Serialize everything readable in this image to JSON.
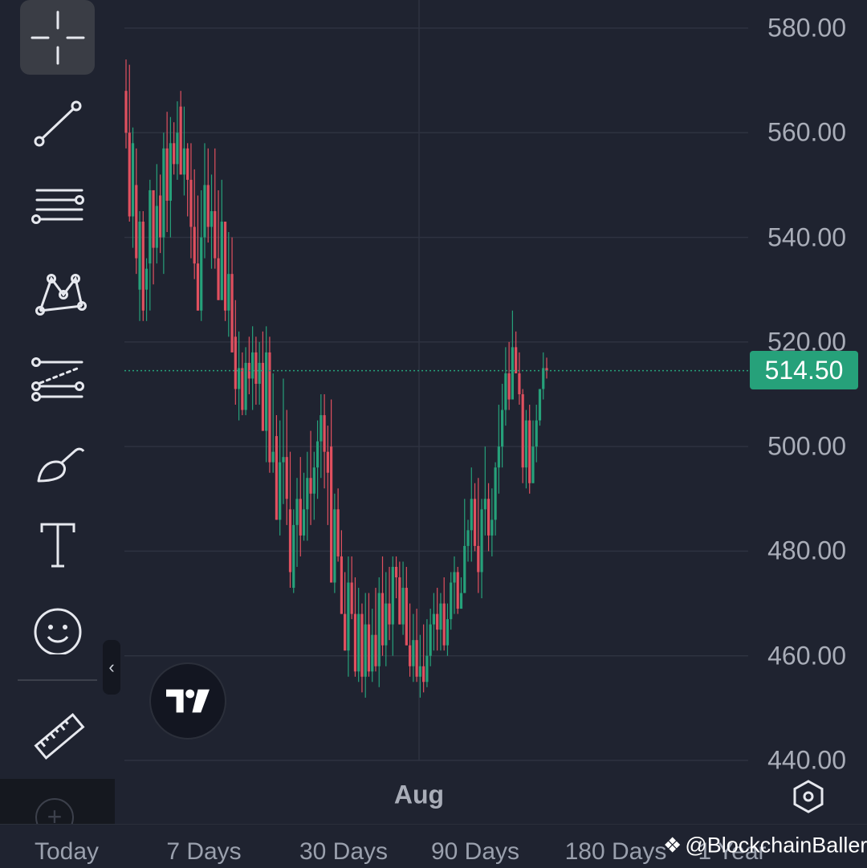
{
  "toolbar": {
    "tools": [
      {
        "name": "crosshair-tool",
        "active": true
      },
      {
        "name": "trend-line-tool"
      },
      {
        "name": "horizontal-lines-tool"
      },
      {
        "name": "pattern-tool"
      },
      {
        "name": "prediction-tool"
      },
      {
        "name": "brush-tool"
      },
      {
        "name": "text-tool"
      },
      {
        "name": "emoji-tool"
      },
      {
        "name": "ruler-tool"
      }
    ],
    "collapse_glyph": "‹",
    "add_glyph": "+"
  },
  "price_axis": {
    "labels": [
      "580.00",
      "560.00",
      "540.00",
      "520.00",
      "500.00",
      "480.00",
      "460.00",
      "440.00"
    ],
    "current_price": "514.50"
  },
  "time_axis": {
    "label": "Aug"
  },
  "ranges": [
    "Today",
    "7 Days",
    "30 Days",
    "90 Days",
    "180 Days",
    "1 Year"
  ],
  "watermark": "@BlockchainBaller",
  "colors": {
    "up": "#26a17a",
    "down": "#e0505f",
    "background": "#1f2330",
    "grid": "#2e3340"
  },
  "chart_data": {
    "type": "candlestick",
    "xlabel": "",
    "ylabel": "",
    "x_tick_labels": [
      "Aug"
    ],
    "ylim": [
      440,
      580
    ],
    "grid": true,
    "current_price": 514.5,
    "candles": [
      {
        "o": 568,
        "h": 574,
        "l": 557,
        "c": 560
      },
      {
        "o": 560,
        "h": 573,
        "l": 543,
        "c": 544
      },
      {
        "o": 544,
        "h": 561,
        "l": 538,
        "c": 558
      },
      {
        "o": 550,
        "h": 557,
        "l": 533,
        "c": 536
      },
      {
        "o": 530,
        "h": 545,
        "l": 524,
        "c": 543
      },
      {
        "o": 543,
        "h": 545,
        "l": 524,
        "c": 526
      },
      {
        "o": 530,
        "h": 536,
        "l": 524,
        "c": 534
      },
      {
        "o": 535,
        "h": 551,
        "l": 526,
        "c": 549
      },
      {
        "o": 549,
        "h": 549,
        "l": 531,
        "c": 538
      },
      {
        "o": 538,
        "h": 554,
        "l": 535,
        "c": 546
      },
      {
        "o": 548,
        "h": 552,
        "l": 537,
        "c": 540
      },
      {
        "o": 540,
        "h": 560,
        "l": 533,
        "c": 557
      },
      {
        "o": 557,
        "h": 564,
        "l": 541,
        "c": 547
      },
      {
        "o": 547,
        "h": 563,
        "l": 540,
        "c": 558
      },
      {
        "o": 558,
        "h": 562,
        "l": 552,
        "c": 554
      },
      {
        "o": 554,
        "h": 566,
        "l": 551,
        "c": 560
      },
      {
        "o": 565,
        "h": 568,
        "l": 552,
        "c": 552
      },
      {
        "o": 552,
        "h": 565,
        "l": 548,
        "c": 557
      },
      {
        "o": 557,
        "h": 558,
        "l": 544,
        "c": 551
      },
      {
        "o": 551,
        "h": 558,
        "l": 536,
        "c": 542
      },
      {
        "o": 542,
        "h": 553,
        "l": 532,
        "c": 535
      },
      {
        "o": 535,
        "h": 548,
        "l": 526,
        "c": 526
      },
      {
        "o": 526,
        "h": 549,
        "l": 524,
        "c": 540
      },
      {
        "o": 540,
        "h": 558,
        "l": 536,
        "c": 550
      },
      {
        "o": 550,
        "h": 557,
        "l": 539,
        "c": 542
      },
      {
        "o": 542,
        "h": 552,
        "l": 534,
        "c": 545
      },
      {
        "o": 545,
        "h": 557,
        "l": 534,
        "c": 536
      },
      {
        "o": 536,
        "h": 549,
        "l": 528,
        "c": 528
      },
      {
        "o": 528,
        "h": 551,
        "l": 528,
        "c": 543
      },
      {
        "o": 543,
        "h": 543,
        "l": 524,
        "c": 526
      },
      {
        "o": 526,
        "h": 541,
        "l": 521,
        "c": 533
      },
      {
        "o": 533,
        "h": 540,
        "l": 518,
        "c": 518
      },
      {
        "o": 521,
        "h": 528,
        "l": 508,
        "c": 511
      },
      {
        "o": 511,
        "h": 522,
        "l": 505,
        "c": 515
      },
      {
        "o": 515,
        "h": 518,
        "l": 506,
        "c": 507
      },
      {
        "o": 507,
        "h": 519,
        "l": 506,
        "c": 516
      },
      {
        "o": 516,
        "h": 521,
        "l": 510,
        "c": 513
      },
      {
        "o": 513,
        "h": 523,
        "l": 507,
        "c": 518
      },
      {
        "o": 518,
        "h": 521,
        "l": 508,
        "c": 512
      },
      {
        "o": 512,
        "h": 520,
        "l": 508,
        "c": 516
      },
      {
        "o": 516,
        "h": 522,
        "l": 503,
        "c": 503
      },
      {
        "o": 503,
        "h": 523,
        "l": 497,
        "c": 518
      },
      {
        "o": 518,
        "h": 521,
        "l": 495,
        "c": 497
      },
      {
        "o": 497,
        "h": 514,
        "l": 495,
        "c": 499
      },
      {
        "o": 502,
        "h": 506,
        "l": 486,
        "c": 486
      },
      {
        "o": 486,
        "h": 505,
        "l": 483,
        "c": 497
      },
      {
        "o": 497,
        "h": 513,
        "l": 489,
        "c": 498
      },
      {
        "o": 498,
        "h": 507,
        "l": 485,
        "c": 490
      },
      {
        "o": 488,
        "h": 499,
        "l": 473,
        "c": 476
      },
      {
        "o": 473,
        "h": 488,
        "l": 472,
        "c": 485
      },
      {
        "o": 485,
        "h": 494,
        "l": 477,
        "c": 490
      },
      {
        "o": 490,
        "h": 498,
        "l": 479,
        "c": 483
      },
      {
        "o": 483,
        "h": 495,
        "l": 482,
        "c": 488
      },
      {
        "o": 488,
        "h": 499,
        "l": 482,
        "c": 494
      },
      {
        "o": 494,
        "h": 503,
        "l": 485,
        "c": 491
      },
      {
        "o": 491,
        "h": 499,
        "l": 486,
        "c": 496
      },
      {
        "o": 496,
        "h": 505,
        "l": 490,
        "c": 501
      },
      {
        "o": 501,
        "h": 510,
        "l": 494,
        "c": 506
      },
      {
        "o": 506,
        "h": 510,
        "l": 492,
        "c": 499
      },
      {
        "o": 499,
        "h": 504,
        "l": 485,
        "c": 495
      },
      {
        "o": 500,
        "h": 509,
        "l": 474,
        "c": 474
      },
      {
        "o": 474,
        "h": 491,
        "l": 472,
        "c": 488
      },
      {
        "o": 488,
        "h": 492,
        "l": 478,
        "c": 479
      },
      {
        "o": 479,
        "h": 484,
        "l": 468,
        "c": 468
      },
      {
        "o": 468,
        "h": 476,
        "l": 461,
        "c": 461
      },
      {
        "o": 461,
        "h": 479,
        "l": 456,
        "c": 474
      },
      {
        "o": 474,
        "h": 479,
        "l": 467,
        "c": 468
      },
      {
        "o": 468,
        "h": 475,
        "l": 456,
        "c": 457
      },
      {
        "o": 457,
        "h": 473,
        "l": 455,
        "c": 468
      },
      {
        "o": 468,
        "h": 470,
        "l": 453,
        "c": 456
      },
      {
        "o": 456,
        "h": 472,
        "l": 452,
        "c": 466
      },
      {
        "o": 466,
        "h": 472,
        "l": 456,
        "c": 457
      },
      {
        "o": 457,
        "h": 469,
        "l": 455,
        "c": 464
      },
      {
        "o": 464,
        "h": 473,
        "l": 457,
        "c": 458
      },
      {
        "o": 458,
        "h": 475,
        "l": 454,
        "c": 472
      },
      {
        "o": 472,
        "h": 479,
        "l": 460,
        "c": 462
      },
      {
        "o": 462,
        "h": 476,
        "l": 458,
        "c": 470
      },
      {
        "o": 470,
        "h": 477,
        "l": 463,
        "c": 466
      },
      {
        "o": 466,
        "h": 479,
        "l": 460,
        "c": 477
      },
      {
        "o": 477,
        "h": 479,
        "l": 471,
        "c": 475
      },
      {
        "o": 475,
        "h": 478,
        "l": 466,
        "c": 466
      },
      {
        "o": 466,
        "h": 478,
        "l": 464,
        "c": 473
      },
      {
        "o": 473,
        "h": 477,
        "l": 462,
        "c": 462
      },
      {
        "o": 462,
        "h": 470,
        "l": 456,
        "c": 458
      },
      {
        "o": 458,
        "h": 468,
        "l": 455,
        "c": 463
      },
      {
        "o": 463,
        "h": 469,
        "l": 455,
        "c": 456
      },
      {
        "o": 456,
        "h": 464,
        "l": 452,
        "c": 458
      },
      {
        "o": 458,
        "h": 466,
        "l": 453,
        "c": 455
      },
      {
        "o": 455,
        "h": 467,
        "l": 454,
        "c": 460
      },
      {
        "o": 460,
        "h": 469,
        "l": 458,
        "c": 466
      },
      {
        "o": 466,
        "h": 472,
        "l": 461,
        "c": 468
      },
      {
        "o": 468,
        "h": 473,
        "l": 461,
        "c": 465
      },
      {
        "o": 465,
        "h": 472,
        "l": 461,
        "c": 470
      },
      {
        "o": 470,
        "h": 475,
        "l": 461,
        "c": 462
      },
      {
        "o": 462,
        "h": 470,
        "l": 460,
        "c": 467
      },
      {
        "o": 467,
        "h": 476,
        "l": 465,
        "c": 474
      },
      {
        "o": 474,
        "h": 479,
        "l": 468,
        "c": 476
      },
      {
        "o": 476,
        "h": 477,
        "l": 468,
        "c": 469
      },
      {
        "o": 469,
        "h": 475,
        "l": 469,
        "c": 472
      },
      {
        "o": 472,
        "h": 490,
        "l": 472,
        "c": 481
      },
      {
        "o": 481,
        "h": 486,
        "l": 478,
        "c": 484
      },
      {
        "o": 484,
        "h": 496,
        "l": 478,
        "c": 490
      },
      {
        "o": 490,
        "h": 493,
        "l": 480,
        "c": 481
      },
      {
        "o": 481,
        "h": 494,
        "l": 472,
        "c": 476
      },
      {
        "o": 476,
        "h": 490,
        "l": 471,
        "c": 488
      },
      {
        "o": 488,
        "h": 500,
        "l": 483,
        "c": 490
      },
      {
        "o": 490,
        "h": 493,
        "l": 480,
        "c": 483
      },
      {
        "o": 483,
        "h": 492,
        "l": 479,
        "c": 486
      },
      {
        "o": 486,
        "h": 497,
        "l": 483,
        "c": 496
      },
      {
        "o": 496,
        "h": 508,
        "l": 491,
        "c": 500
      },
      {
        "o": 500,
        "h": 512,
        "l": 496,
        "c": 507
      },
      {
        "o": 507,
        "h": 519,
        "l": 504,
        "c": 514
      },
      {
        "o": 514,
        "h": 520,
        "l": 507,
        "c": 509
      },
      {
        "o": 509,
        "h": 526,
        "l": 509,
        "c": 519
      },
      {
        "o": 519,
        "h": 522,
        "l": 514,
        "c": 514
      },
      {
        "o": 514,
        "h": 518,
        "l": 508,
        "c": 510
      },
      {
        "o": 510,
        "h": 511,
        "l": 493,
        "c": 496
      },
      {
        "o": 496,
        "h": 507,
        "l": 492,
        "c": 505
      },
      {
        "o": 505,
        "h": 508,
        "l": 491,
        "c": 493
      },
      {
        "o": 493,
        "h": 505,
        "l": 493,
        "c": 500
      },
      {
        "o": 500,
        "h": 508,
        "l": 497,
        "c": 505
      },
      {
        "o": 505,
        "h": 511,
        "l": 504,
        "c": 511
      },
      {
        "o": 511,
        "h": 518,
        "l": 509,
        "c": 515
      },
      {
        "o": 515,
        "h": 517,
        "l": 513,
        "c": 514.5
      }
    ]
  }
}
